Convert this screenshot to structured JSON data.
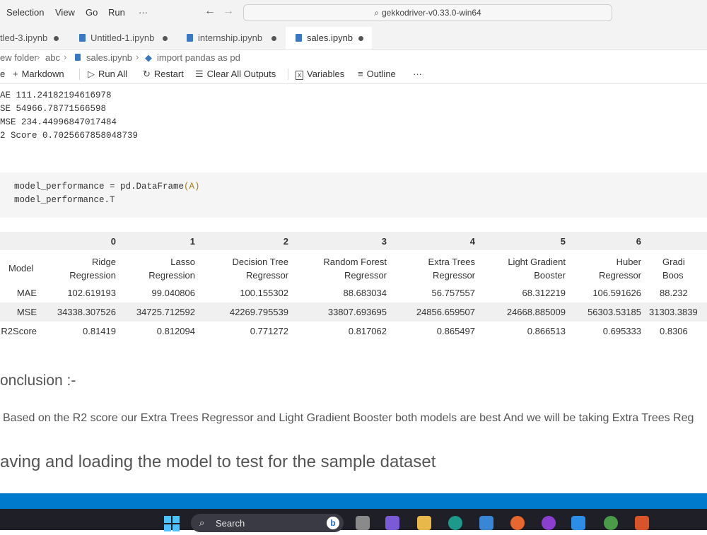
{
  "menu": [
    "Selection",
    "View",
    "Go",
    "Run",
    "···"
  ],
  "command_center": "gekkodriver-v0.33.0-win64",
  "tabs": [
    {
      "label": "tled-3.ipynb"
    },
    {
      "label": "Untitled-1.ipynb"
    },
    {
      "label": "internship.ipynb"
    },
    {
      "label": "sales.ipynb"
    }
  ],
  "breadcrumb": [
    "ew folder",
    "abc",
    "sales.ipynb",
    "import pandas as pd"
  ],
  "toolbar": {
    "code": "e",
    "markdown": "Markdown",
    "run_all": "Run All",
    "restart": "Restart",
    "clear_outputs": "Clear All Outputs",
    "variables": "Variables",
    "outline": "Outline",
    "more": "···"
  },
  "metrics_output": [
    "AE 111.24182194616978",
    "SE 54966.78771566598",
    "MSE 234.44996847017484",
    "2 Score 0.7025667858048739"
  ],
  "code_lines": [
    {
      "pre": "model_performance = pd.DataFrame",
      "arg": "(A)"
    },
    {
      "pre": "model_performance.T",
      "arg": ""
    }
  ],
  "table": {
    "col_index": [
      "0",
      "1",
      "2",
      "3",
      "4",
      "5",
      "6"
    ],
    "row_header": "Model",
    "model_names": [
      [
        "Ridge",
        "Regression"
      ],
      [
        "Lasso",
        "Regression"
      ],
      [
        "Decision Tree",
        "Regressor"
      ],
      [
        "Random Forest",
        "Regressor"
      ],
      [
        "Extra Trees",
        "Regressor"
      ],
      [
        "Light Gradient",
        "Booster"
      ],
      [
        "Huber",
        "Regressor"
      ],
      [
        "Gradi",
        "Boos"
      ]
    ],
    "rows": [
      {
        "label": "MAE",
        "values": [
          "102.619193",
          "99.040806",
          "100.155302",
          "88.683034",
          "56.757557",
          "68.312219",
          "106.591626",
          "88.232"
        ]
      },
      {
        "label": "MSE",
        "values": [
          "34338.307526",
          "34725.712592",
          "42269.795539",
          "33807.693695",
          "24856.659507",
          "24668.885009",
          "56303.53185",
          "31303.3839"
        ]
      },
      {
        "label": "R2Score",
        "values": [
          "0.81419",
          "0.812094",
          "0.771272",
          "0.817062",
          "0.865497",
          "0.866513",
          "0.695333",
          "0.8306"
        ]
      }
    ]
  },
  "conclusion_heading": "onclusion :-",
  "conclusion_text": "Based on the R2 score our Extra Trees Regressor and Light Gradient Booster both models are best And we will be taking Extra Trees Reg",
  "saving_heading": "aving and loading the model to test for the sample dataset",
  "taskbar": {
    "search": "Search"
  },
  "colors": {
    "accent": "#007acc",
    "taskbar": "#1f1f28"
  }
}
